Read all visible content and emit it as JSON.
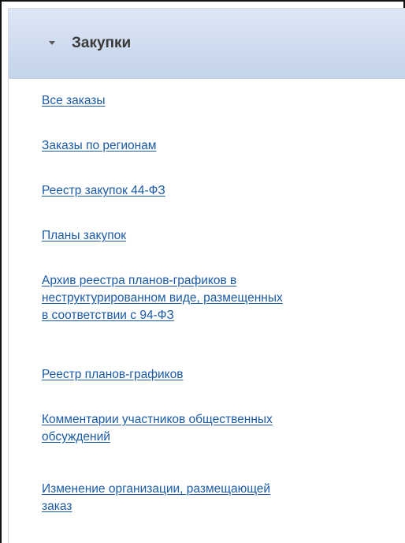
{
  "panel": {
    "title": "Закупки",
    "toggle_icon": "triangle-down",
    "colors": {
      "header_bg": "#cfdcef",
      "title": "#3a3a3a",
      "link": "#1a5aa6"
    }
  },
  "links": [
    {
      "lines": [
        "Все заказы"
      ]
    },
    {
      "lines": [
        "Заказы по регионам"
      ]
    },
    {
      "lines": [
        "Реестр закупок 44-ФЗ"
      ]
    },
    {
      "lines": [
        "Планы закупок"
      ]
    },
    {
      "lines": [
        "Архив реестра планов-графиков в",
        "неструктурированном виде, размещенных",
        "в соответствии с 94-ФЗ"
      ]
    },
    {
      "lines": [
        "Реестр планов-графиков"
      ]
    },
    {
      "lines": [
        "Комментарии участников общественных",
        "обсуждений"
      ]
    },
    {
      "lines": [
        "Изменение организации, размещающей",
        "заказ"
      ]
    }
  ]
}
